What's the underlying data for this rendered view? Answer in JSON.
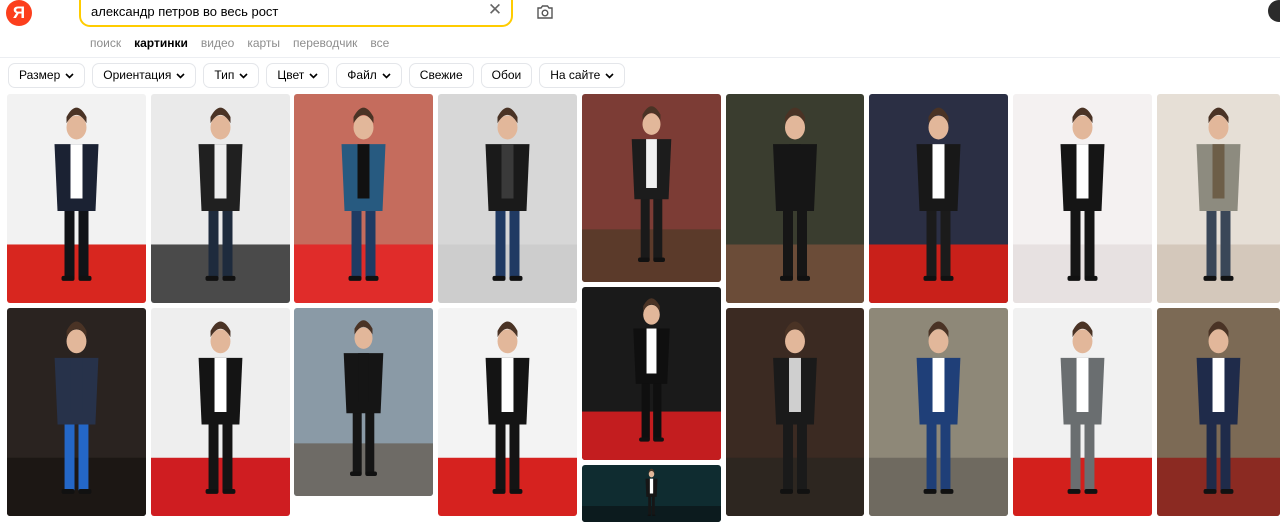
{
  "search": {
    "query": "александр петров во весь рост"
  },
  "logo": {
    "letter": "Я"
  },
  "tabs": [
    {
      "label": "поиск",
      "active": false
    },
    {
      "label": "картинки",
      "active": true
    },
    {
      "label": "видео",
      "active": false
    },
    {
      "label": "карты",
      "active": false
    },
    {
      "label": "переводчик",
      "active": false
    },
    {
      "label": "все",
      "active": false
    }
  ],
  "filters": [
    {
      "label": "Размер",
      "dropdown": true
    },
    {
      "label": "Ориентация",
      "dropdown": true
    },
    {
      "label": "Тип",
      "dropdown": true
    },
    {
      "label": "Цвет",
      "dropdown": true
    },
    {
      "label": "Файл",
      "dropdown": true
    },
    {
      "label": "Свежие",
      "dropdown": false
    },
    {
      "label": "Обои",
      "dropdown": false
    },
    {
      "label": "На сайте",
      "dropdown": true
    }
  ],
  "images": [
    {
      "name": "result-image-1",
      "bg": "#f2f2f2",
      "floor": "#d8261f",
      "suit": "#1b2233",
      "shirt": "#ffffff",
      "legs": "#111317"
    },
    {
      "name": "result-image-2",
      "bg": "#eaeaea",
      "floor": "#4a4a4a",
      "suit": "#202020",
      "shirt": "#eeeeee",
      "legs": "#1e2b3d"
    },
    {
      "name": "result-image-3",
      "bg": "#c56c5d",
      "floor": "#e02c2a",
      "suit": "#275a80",
      "shirt": "#111111",
      "legs": "#1f3b63"
    },
    {
      "name": "result-image-4",
      "bg": "#d7d7d7",
      "floor": "#cdcdcd",
      "suit": "#1a1a1a",
      "shirt": "#3a3a3a",
      "legs": "#203a63"
    },
    {
      "name": "result-image-5",
      "bg": "#7c3c35",
      "floor": "#5b3a2a",
      "suit": "#1c1c1c",
      "shirt": "#f0f0f0",
      "legs": "#1a1a1a"
    },
    {
      "name": "result-image-6",
      "bg": "#3a3d2f",
      "floor": "#6b4c38",
      "suit": "#161616",
      "shirt": "#161616",
      "legs": "#161616"
    },
    {
      "name": "result-image-7",
      "bg": "#2b2f44",
      "floor": "#c9201a",
      "suit": "#181818",
      "shirt": "#ffffff",
      "legs": "#1b1b1b"
    },
    {
      "name": "result-image-8",
      "bg": "#f4f1f1",
      "floor": "#e7e1e1",
      "suit": "#151515",
      "shirt": "#ffffff",
      "legs": "#151515"
    },
    {
      "name": "result-image-9",
      "bg": "#e6dfd6",
      "floor": "#d4c8bb",
      "suit": "#8d8b7f",
      "shirt": "#6d5e48",
      "legs": "#3a4758"
    },
    {
      "name": "result-image-10",
      "bg": "#2a2320",
      "floor": "#1c1714",
      "suit": "#27324a",
      "shirt": "#27324a",
      "legs": "#2467c7"
    },
    {
      "name": "result-image-11",
      "bg": "#eeeeee",
      "floor": "#cf1d21",
      "suit": "#141414",
      "shirt": "#ffffff",
      "legs": "#141414"
    },
    {
      "name": "result-image-12",
      "bg": "#8a9aa6",
      "floor": "#6e6b66",
      "suit": "#151515",
      "shirt": "#151515",
      "legs": "#151515"
    },
    {
      "name": "result-image-13",
      "bg": "#f3f3f3",
      "floor": "#d6221f",
      "suit": "#141414",
      "shirt": "#ffffff",
      "legs": "#141414"
    },
    {
      "name": "result-image-14",
      "bg": "#1a1a1a",
      "floor": "#c31d1f",
      "suit": "#0f0f0f",
      "shirt": "#ffffff",
      "legs": "#0f0f0f"
    },
    {
      "name": "result-image-15",
      "bg": "#3b2a22",
      "floor": "#2d2620",
      "suit": "#1a1a1a",
      "shirt": "#cfcfcf",
      "legs": "#1a1a1a"
    },
    {
      "name": "result-image-16",
      "bg": "#8e8878",
      "floor": "#6f6a60",
      "suit": "#1f3f78",
      "shirt": "#ffffff",
      "legs": "#1f3f78"
    },
    {
      "name": "result-image-17",
      "bg": "#f1f1f1",
      "floor": "#d3201c",
      "suit": "#6a6e70",
      "shirt": "#ffffff",
      "legs": "#6a6e70"
    },
    {
      "name": "result-image-18",
      "bg": "#7c6a55",
      "floor": "#8b2a22",
      "suit": "#1f2b4a",
      "shirt": "#ffffff",
      "legs": "#1f2b4a"
    },
    {
      "name": "result-image-19",
      "bg": "#0f2c30",
      "floor": "#0c1b1e",
      "suit": "#161616",
      "shirt": "#ffffff",
      "legs": "#161616"
    }
  ]
}
